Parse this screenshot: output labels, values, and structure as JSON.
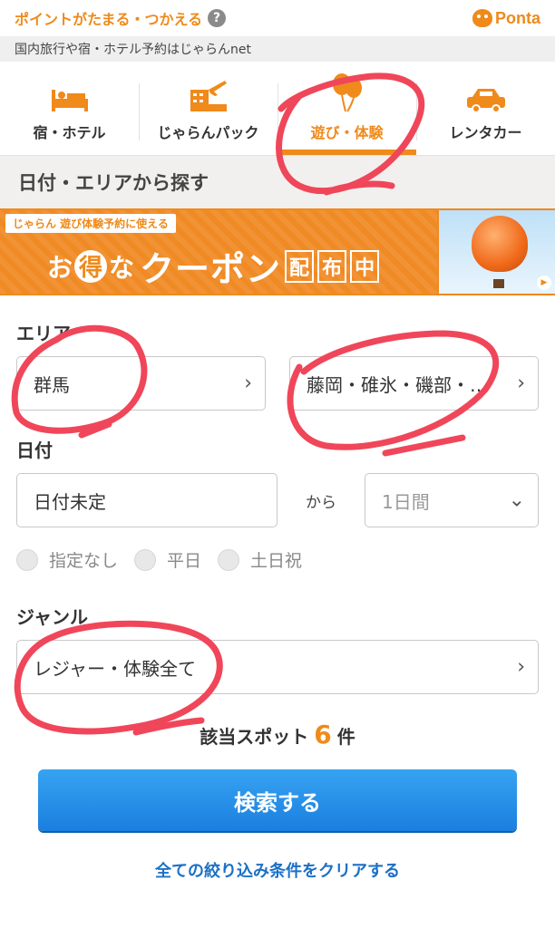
{
  "topbar": {
    "points_label": "ポイントがたまる・つかえる",
    "help": "?",
    "brand": "Ponta"
  },
  "subbar": {
    "text": "国内旅行や宿・ホテル予約はじゃらんnet"
  },
  "tabs": [
    {
      "label": "宿・ホテル",
      "icon": "bed-icon",
      "active": false
    },
    {
      "label": "じゃらんパック",
      "icon": "plane-hotel-icon",
      "active": false
    },
    {
      "label": "遊び・体験",
      "icon": "balloon-icon",
      "active": true
    },
    {
      "label": "レンタカー",
      "icon": "car-icon",
      "active": false
    }
  ],
  "section_title": "日付・エリアから探す",
  "banner": {
    "tag": "じゃらん 遊び体験予約に使える",
    "o": "お",
    "toku": "得",
    "na": "な",
    "coupon": "クーポン",
    "b1": "配",
    "b2": "布",
    "b3": "中"
  },
  "area": {
    "label": "エリア",
    "prefecture": "群馬",
    "region": "藤岡・碓氷・磯部・…"
  },
  "date": {
    "label": "日付",
    "value": "日付未定",
    "from": "から",
    "duration": "1日間",
    "options": [
      "指定なし",
      "平日",
      "土日祝"
    ]
  },
  "genre": {
    "label": "ジャンル",
    "value": "レジャー・体験全て"
  },
  "result": {
    "prefix": "該当スポット",
    "count": "6",
    "suffix": "件"
  },
  "search_button": "検索する",
  "clear_link": "全ての絞り込み条件をクリアする",
  "colors": {
    "accent": "#ef8a1b",
    "button": "#1a7fe0",
    "annotation": "#f0465a"
  }
}
